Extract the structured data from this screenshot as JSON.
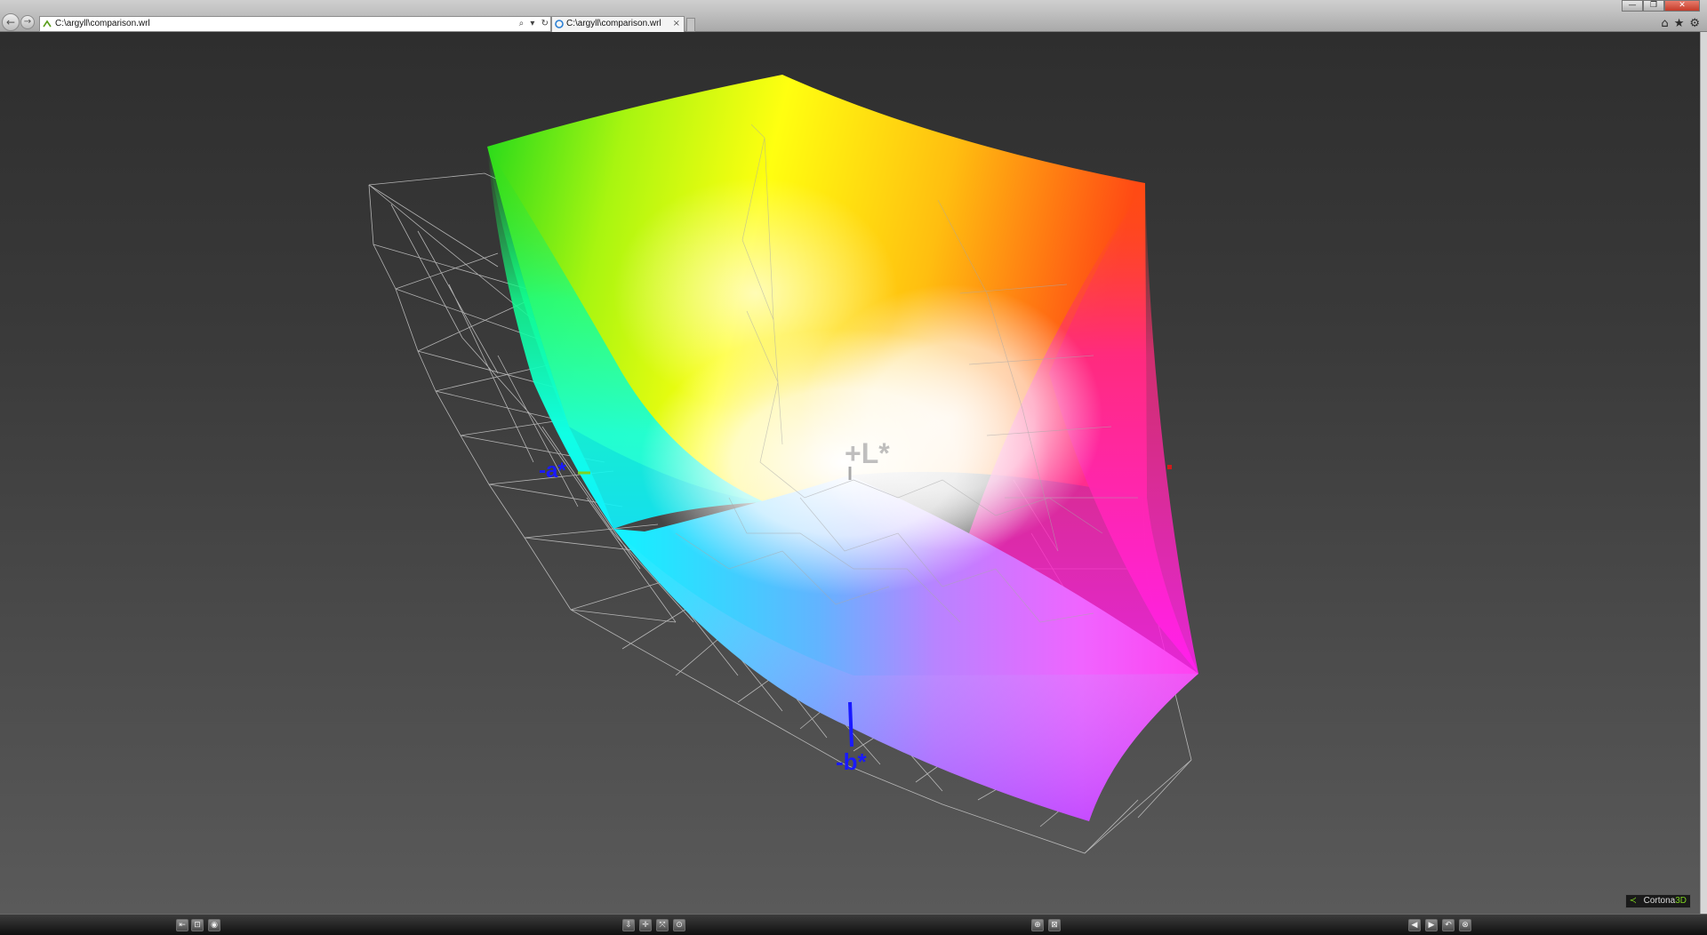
{
  "browser": {
    "address": "C:\\argyll\\comparison.wrl",
    "tab_title": "C:\\argyll\\comparison.wrl",
    "tab_close": "×",
    "nav": {
      "back": "←",
      "forward": "→"
    },
    "address_tools": {
      "search": "⌕",
      "dropdown": "▾",
      "refresh": "↻"
    },
    "window_controls": {
      "minimize": "—",
      "maximize": "❐",
      "close": "✕"
    },
    "tools": {
      "home": "⌂",
      "favorites": "★",
      "settings": "⚙"
    }
  },
  "viewer": {
    "labels": {
      "l_axis": "+L*",
      "a_axis": "-a*",
      "b_axis": "-b*"
    },
    "colors": {
      "l_axis": "#a8a8a8",
      "a_axis": "#1a1aff",
      "b_axis": "#1a1aff",
      "a_axis_line": "#7ed321",
      "a_axis_marker": "#d21a1a"
    },
    "logo": {
      "brand": "Cortona",
      "suffix": "3D"
    }
  },
  "toolbar": {
    "left": [
      "⇤",
      "⊡",
      "◉"
    ],
    "center": [
      "⇩",
      "✛",
      "⤧",
      "⊙"
    ],
    "mid": [
      "⊕",
      "⊠"
    ],
    "right": [
      "◀",
      "▶",
      "↶",
      "⊗"
    ]
  }
}
